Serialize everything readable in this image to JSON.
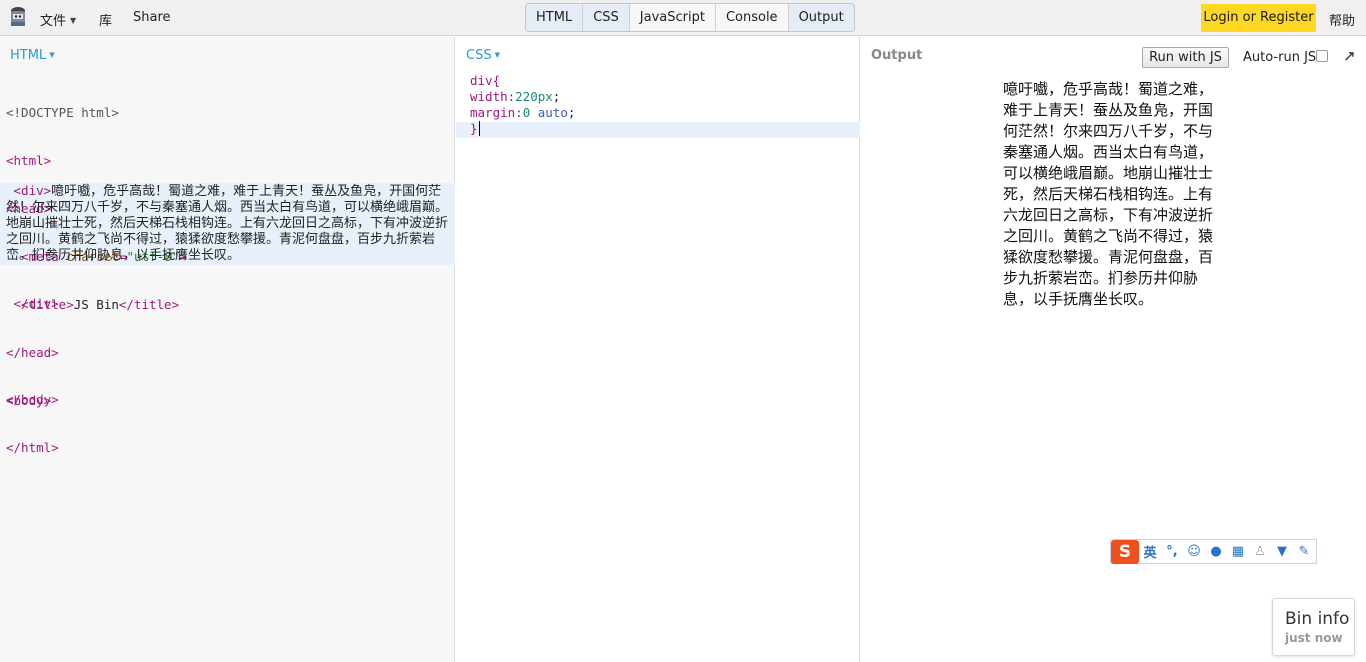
{
  "toolbar": {
    "file_menu": "文件",
    "library": "库",
    "share": "Share",
    "tabs": [
      "HTML",
      "CSS",
      "JavaScript",
      "Console",
      "Output"
    ],
    "login": "Login or Register",
    "help": "帮助"
  },
  "html_panel": {
    "label": "HTML",
    "lines": [
      "<!DOCTYPE html>",
      "<html>",
      "<head>",
      "  <meta charset=\"utf-8\">",
      "  <title>JS Bin</title>",
      "</head>",
      "<body>",
      " </div>",
      "",
      "</body>",
      "</html>"
    ],
    "div_open": " <div>",
    "div_text": "噫吁嚱，危乎高哉！蜀道之难，难于上青天！蚕丛及鱼凫，开国何茫然！尔来四万八千岁，不与秦塞通人烟。西当太白有鸟道，可以横绝峨眉巅。地崩山摧壮士死，然后天梯石栈相钩连。上有六龙回日之高标，下有冲波逆折之回川。黄鹤之飞尚不得过，猿猱欲度愁攀援。青泥何盘盘，百步九折萦岩峦。扪参历井仰胁息，以手抚膺坐长叹。"
  },
  "css_panel": {
    "label": "CSS",
    "selector": "div{",
    "prop1": "width:",
    "val1": "220px",
    "prop2": "margin:",
    "val2a": "0",
    "val2b": "auto",
    "close": "}"
  },
  "output_panel": {
    "label": "Output",
    "run_button": "Run with JS",
    "autorun_label": "Auto-run JS",
    "autorun_checked": false,
    "text": "噫吁嚱，危乎高哉！蜀道之难，难于上青天！蚕丛及鱼凫，开国何茫然！尔来四万八千岁，不与秦塞通人烟。西当太白有鸟道，可以横绝峨眉巅。地崩山摧壮士死，然后天梯石栈相钩连。上有六龙回日之高标，下有冲波逆折之回川。黄鹤之飞尚不得过，猿猱欲度愁攀援。青泥何盘盘，百步九折萦岩峦。扪参历井仰胁息，以手抚膺坐长叹。"
  },
  "ime_bar": {
    "logo": "S",
    "mode": "英",
    "icons": [
      "punctuation-icon",
      "emoji-icon",
      "microphone-icon",
      "keyboard-icon",
      "user-icon",
      "skin-icon",
      "tools-icon"
    ]
  },
  "bin_info": {
    "title": "Bin info",
    "subtitle": "just now"
  },
  "colors": {
    "accent": "#2b99d9",
    "login_bg": "#ffd823",
    "tag": "#a3177c",
    "ime_logo": "#f04f1e"
  }
}
